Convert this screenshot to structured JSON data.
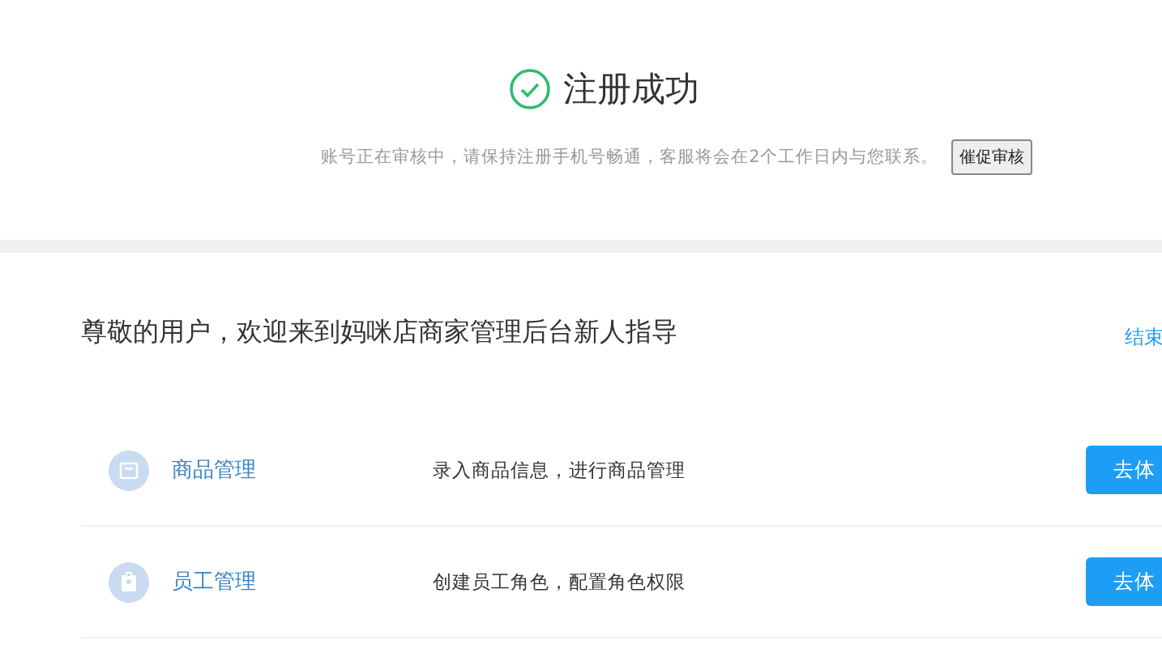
{
  "status": {
    "title": "注册成功",
    "message": "账号正在审核中，请保持注册手机号畅通，客服将会在2个工作日内与您联系。",
    "button": "催促审核"
  },
  "guide": {
    "heading": "尊敬的用户，欢迎来到妈咪店商家管理后台新人指导",
    "end_link": "结束",
    "rows": [
      {
        "kind": "bag",
        "name": "商品管理",
        "description": "录入商品信息，进行商品管理",
        "button": "去体"
      },
      {
        "kind": "badge",
        "name": "员工管理",
        "description": "创建员工角色，配置角色权限",
        "button": "去体"
      }
    ]
  }
}
